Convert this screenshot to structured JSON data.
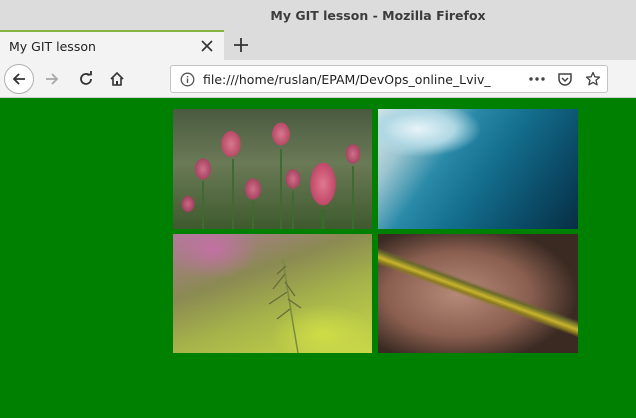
{
  "window": {
    "title": "My GIT lesson - Mozilla Firefox"
  },
  "tabs": [
    {
      "label": "My GIT lesson",
      "active": true
    }
  ],
  "toolbar": {
    "back_icon": "back-arrow-icon",
    "forward_icon": "forward-arrow-icon",
    "reload_icon": "reload-icon",
    "home_icon": "home-icon"
  },
  "urlbar": {
    "url": "file:///home/ruslan/EPAM/DevOps_online_Lviv_",
    "info_icon": "info-icon",
    "actions": [
      "page-actions-icon",
      "pocket-icon",
      "bookmark-star-icon"
    ]
  },
  "page": {
    "background_color": "#008000",
    "images": [
      {
        "subject": "pink tulips"
      },
      {
        "subject": "ocean wave"
      },
      {
        "subject": "grass stem"
      },
      {
        "subject": "road with yellow line"
      }
    ]
  }
}
